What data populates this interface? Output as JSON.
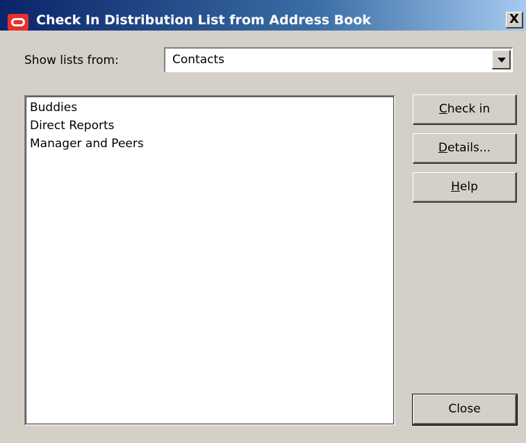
{
  "window": {
    "title": "Check In Distribution List from Address Book",
    "close_glyph": "X"
  },
  "source": {
    "label": "Show lists from:",
    "value": "Contacts"
  },
  "lists": {
    "items": [
      "Buddies",
      "Direct Reports",
      "Manager and Peers"
    ]
  },
  "buttons": {
    "check_in": {
      "mnemonic": "C",
      "rest": "heck in"
    },
    "details": {
      "mnemonic": "D",
      "rest": "etails..."
    },
    "help": {
      "mnemonic": "H",
      "rest": "elp"
    },
    "close": "Close"
  },
  "colors": {
    "titlebar_start": "#0a246a",
    "titlebar_end": "#a6caf0",
    "dialog_bg": "#d4d0c8",
    "app_icon": "#e8302a"
  }
}
